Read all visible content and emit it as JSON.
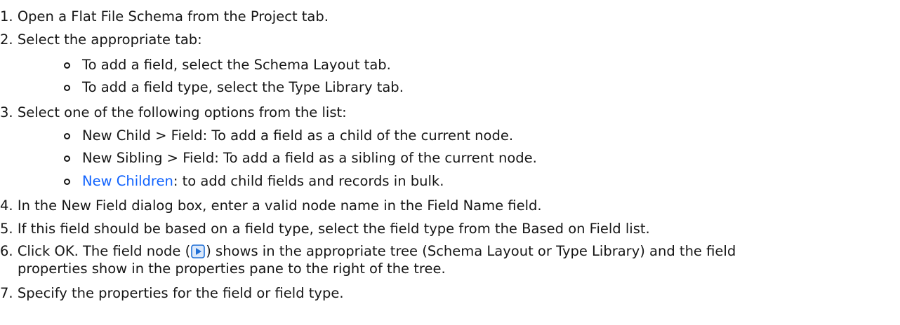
{
  "steps": [
    {
      "number": "1.",
      "text": "Open a Flat File Schema from the Project tab."
    },
    {
      "number": "2.",
      "text": "Select the appropriate tab:",
      "substeps": [
        "To add a field, select the Schema Layout tab.",
        "To add a field type, select the Type Library tab."
      ]
    },
    {
      "number": "3.",
      "text": "Select one of the following options from the list:",
      "substeps": [
        "New Child > Field: To add a field as a child of the current node.",
        "New Sibling > Field: To add a field as a sibling of the current node."
      ],
      "link_substep": {
        "link": "New Children",
        "rest": ": to add child fields and records in bulk."
      }
    },
    {
      "number": "4.",
      "text": "In the New Field dialog box, enter a valid node name in the Field Name field."
    },
    {
      "number": "5.",
      "text": "If this field should be based on a field type, select the field type from the Based on Field list."
    },
    {
      "number": "6.",
      "text_before_icon": "Click OK. The field node (",
      "text_after_icon": ") shows in the appropriate tree (Schema Layout or Type Library) and the field",
      "text_line2": "properties show in the properties pane to the right of the tree.",
      "icon": "field-node-icon"
    },
    {
      "number": "7.",
      "text": "Specify the properties for the field or field type."
    }
  ],
  "colors": {
    "text": "#161616",
    "link": "#0f62fe",
    "icon_blue": "#1f6fd6"
  }
}
